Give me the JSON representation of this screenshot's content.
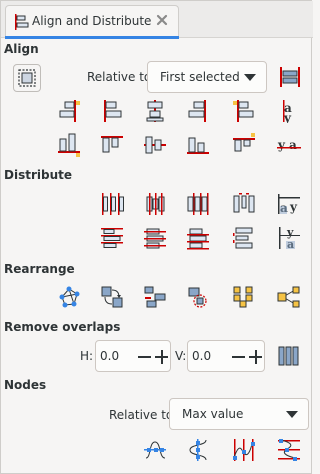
{
  "tab": {
    "label": "Align and Distribute",
    "close_icon": "close-icon",
    "icon": "align-distribute-icon"
  },
  "sections": {
    "align": "Align",
    "distribute": "Distribute",
    "rearrange": "Rearrange",
    "remove_overlaps": "Remove overlaps",
    "nodes": "Nodes"
  },
  "align": {
    "relative_to_label": "Relative to:",
    "relative_to_value": "First selected"
  },
  "remove_overlaps": {
    "h_label": "H:",
    "h_value": "0.0",
    "v_label": "V:",
    "v_value": "0.0"
  },
  "nodes": {
    "relative_to_label": "Relative to:",
    "relative_to_value": "Max value"
  },
  "colors": {
    "accent": "#3584e4",
    "guide_red": "#cc0000",
    "object_blue": "#8aa6c8",
    "highlight_yellow": "#f6c344"
  }
}
